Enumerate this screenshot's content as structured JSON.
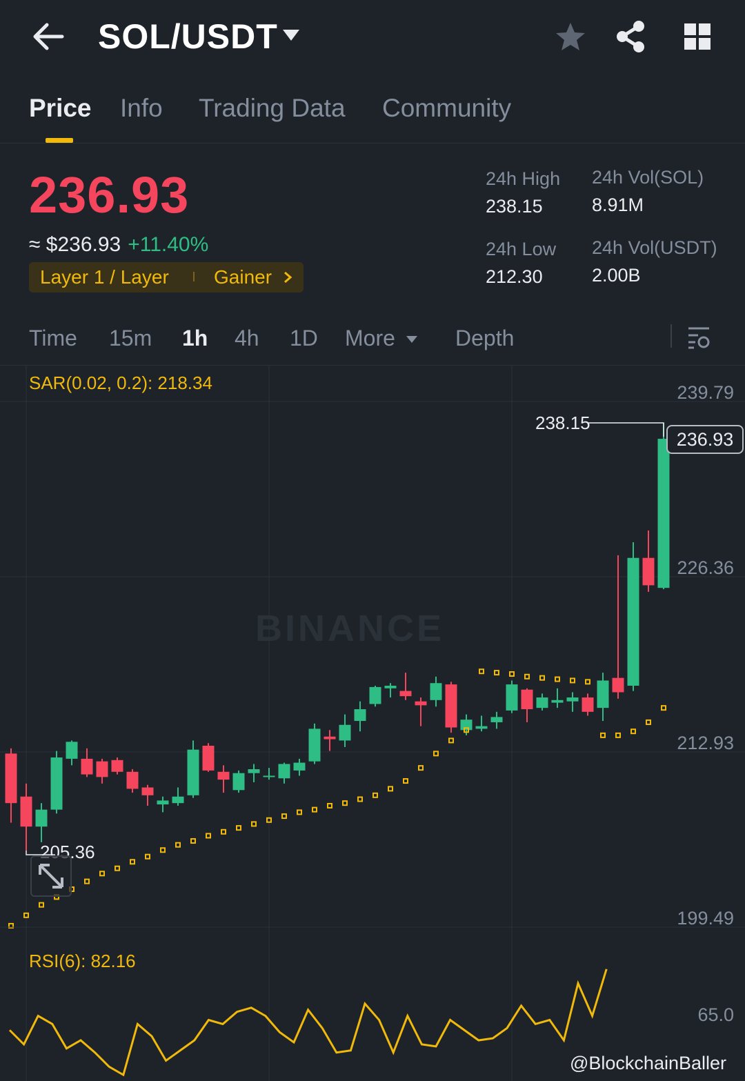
{
  "header": {
    "pair": "SOL/USDT",
    "icons": [
      "arrow-left-icon",
      "caret-down-icon",
      "star-icon",
      "share-icon",
      "grid-icon"
    ]
  },
  "tabs": [
    {
      "label": "Price",
      "active": true
    },
    {
      "label": "Info",
      "active": false
    },
    {
      "label": "Trading Data",
      "active": false
    },
    {
      "label": "Community",
      "active": false
    }
  ],
  "ticker": {
    "last_price": "236.93",
    "usd_value": "≈ $236.93",
    "change_pct": "+11.40%",
    "tag_1": "Layer 1 / Layer",
    "tag_2": "Gainer",
    "high_label": "24h High",
    "high_value": "238.15",
    "low_label": "24h Low",
    "low_value": "212.30",
    "vol_sol_label": "24h Vol(SOL)",
    "vol_sol_value": "8.91M",
    "vol_usdt_label": "24h Vol(USDT)",
    "vol_usdt_value": "2.00B"
  },
  "timeframes": {
    "items": [
      {
        "label": "Time",
        "active": false
      },
      {
        "label": "15m",
        "active": false
      },
      {
        "label": "1h",
        "active": true
      },
      {
        "label": "4h",
        "active": false
      },
      {
        "label": "1D",
        "active": false
      },
      {
        "label": "More",
        "active": false
      },
      {
        "label": "Depth",
        "active": false
      }
    ]
  },
  "chart": {
    "sar_label": "SAR(0.02, 0.2): 218.34",
    "rsi_label": "RSI(6): 82.16",
    "last_price_tag": "236.93",
    "high_marker": "238.15",
    "low_marker": "205.36",
    "watermark": "BINANCE",
    "credit": "@BlockchainBaller",
    "colors": {
      "up": "#2ebd85",
      "down": "#f6465d",
      "sar": "#f0b90b",
      "rsi": "#f0b90b",
      "grid": "#2b3139"
    }
  },
  "chart_data": {
    "type": "candlestick",
    "y_ticks": [
      "239.79",
      "226.36",
      "212.93",
      "199.49"
    ],
    "rsi_ticks": [
      "65.0"
    ],
    "ylim": [
      199.49,
      239.79
    ],
    "candles": [
      {
        "o": 212.8,
        "h": 213.2,
        "l": 207.5,
        "c": 209.0
      },
      {
        "o": 209.5,
        "h": 210.5,
        "l": 205.36,
        "c": 207.2
      },
      {
        "o": 207.2,
        "h": 209.0,
        "l": 206.0,
        "c": 208.5
      },
      {
        "o": 208.5,
        "h": 213.0,
        "l": 208.2,
        "c": 212.5
      },
      {
        "o": 212.4,
        "h": 213.8,
        "l": 211.9,
        "c": 213.7
      },
      {
        "o": 212.4,
        "h": 213.2,
        "l": 211.0,
        "c": 211.2
      },
      {
        "o": 212.2,
        "h": 212.4,
        "l": 210.5,
        "c": 211.0
      },
      {
        "o": 212.3,
        "h": 212.5,
        "l": 211.2,
        "c": 211.4
      },
      {
        "o": 211.4,
        "h": 211.6,
        "l": 209.8,
        "c": 210.1
      },
      {
        "o": 210.2,
        "h": 210.4,
        "l": 208.8,
        "c": 209.6
      },
      {
        "o": 208.9,
        "h": 209.5,
        "l": 208.3,
        "c": 209.2
      },
      {
        "o": 209.0,
        "h": 210.2,
        "l": 208.8,
        "c": 209.5
      },
      {
        "o": 209.6,
        "h": 213.8,
        "l": 209.4,
        "c": 213.1
      },
      {
        "o": 213.4,
        "h": 213.6,
        "l": 211.4,
        "c": 211.5
      },
      {
        "o": 211.4,
        "h": 211.9,
        "l": 209.8,
        "c": 210.8
      },
      {
        "o": 210.0,
        "h": 211.5,
        "l": 209.8,
        "c": 211.3
      },
      {
        "o": 211.3,
        "h": 212.0,
        "l": 210.6,
        "c": 211.6
      },
      {
        "o": 211.0,
        "h": 211.7,
        "l": 210.8,
        "c": 211.1
      },
      {
        "o": 210.9,
        "h": 212.1,
        "l": 210.5,
        "c": 212.0
      },
      {
        "o": 211.5,
        "h": 212.4,
        "l": 211.1,
        "c": 212.1
      },
      {
        "o": 212.2,
        "h": 215.1,
        "l": 212.0,
        "c": 214.7
      },
      {
        "o": 214.1,
        "h": 214.6,
        "l": 213.0,
        "c": 213.9
      },
      {
        "o": 213.8,
        "h": 215.8,
        "l": 213.3,
        "c": 215.0
      },
      {
        "o": 215.3,
        "h": 216.8,
        "l": 214.5,
        "c": 216.2
      },
      {
        "o": 216.6,
        "h": 218.0,
        "l": 216.4,
        "c": 217.9
      },
      {
        "o": 217.8,
        "h": 218.2,
        "l": 217.1,
        "c": 218.0
      },
      {
        "o": 217.6,
        "h": 219.0,
        "l": 216.9,
        "c": 217.2
      },
      {
        "o": 216.8,
        "h": 217.1,
        "l": 214.9,
        "c": 216.5
      },
      {
        "o": 216.9,
        "h": 218.7,
        "l": 216.4,
        "c": 218.2
      },
      {
        "o": 218.1,
        "h": 218.3,
        "l": 214.4,
        "c": 214.8
      },
      {
        "o": 214.6,
        "h": 215.8,
        "l": 214.2,
        "c": 215.4
      },
      {
        "o": 214.7,
        "h": 215.7,
        "l": 214.5,
        "c": 214.9
      },
      {
        "o": 215.2,
        "h": 216.0,
        "l": 214.7,
        "c": 215.6
      },
      {
        "o": 216.1,
        "h": 218.4,
        "l": 215.9,
        "c": 218.1
      },
      {
        "o": 217.7,
        "h": 217.8,
        "l": 215.2,
        "c": 216.2
      },
      {
        "o": 216.3,
        "h": 217.4,
        "l": 216.1,
        "c": 217.1
      },
      {
        "o": 216.7,
        "h": 217.8,
        "l": 216.3,
        "c": 216.9
      },
      {
        "o": 216.8,
        "h": 217.5,
        "l": 216.0,
        "c": 217.1
      },
      {
        "o": 217.1,
        "h": 217.4,
        "l": 215.7,
        "c": 216.0
      },
      {
        "o": 216.3,
        "h": 219.0,
        "l": 215.3,
        "c": 218.4
      },
      {
        "o": 218.6,
        "h": 228.0,
        "l": 217.0,
        "c": 217.5
      },
      {
        "o": 218.0,
        "h": 229.0,
        "l": 217.6,
        "c": 227.8
      },
      {
        "o": 227.8,
        "h": 229.9,
        "l": 225.2,
        "c": 225.7
      },
      {
        "o": 225.5,
        "h": 238.15,
        "l": 225.4,
        "c": 236.93
      }
    ],
    "sar": [
      199.6,
      200.4,
      201.2,
      201.8,
      202.4,
      203.0,
      203.6,
      204.0,
      204.5,
      204.9,
      205.4,
      205.8,
      206.1,
      206.5,
      206.8,
      207.1,
      207.4,
      207.7,
      208.0,
      208.3,
      208.5,
      208.8,
      209.0,
      209.3,
      209.6,
      210.1,
      210.7,
      211.7,
      212.8,
      213.8,
      214.6,
      219.1,
      219.0,
      218.9,
      218.7,
      218.6,
      218.5,
      218.4,
      218.3,
      214.2,
      214.2,
      214.5,
      215.2,
      216.3
    ],
    "rsi": [
      55,
      48,
      62,
      58,
      46,
      50,
      44,
      37,
      33,
      58,
      52,
      40,
      45,
      50,
      60,
      58,
      64,
      66,
      62,
      54,
      49,
      65,
      56,
      44,
      45,
      68,
      60,
      44,
      62,
      48,
      47,
      60,
      55,
      50,
      51,
      56,
      67,
      58,
      60,
      50,
      78,
      62,
      85
    ]
  }
}
